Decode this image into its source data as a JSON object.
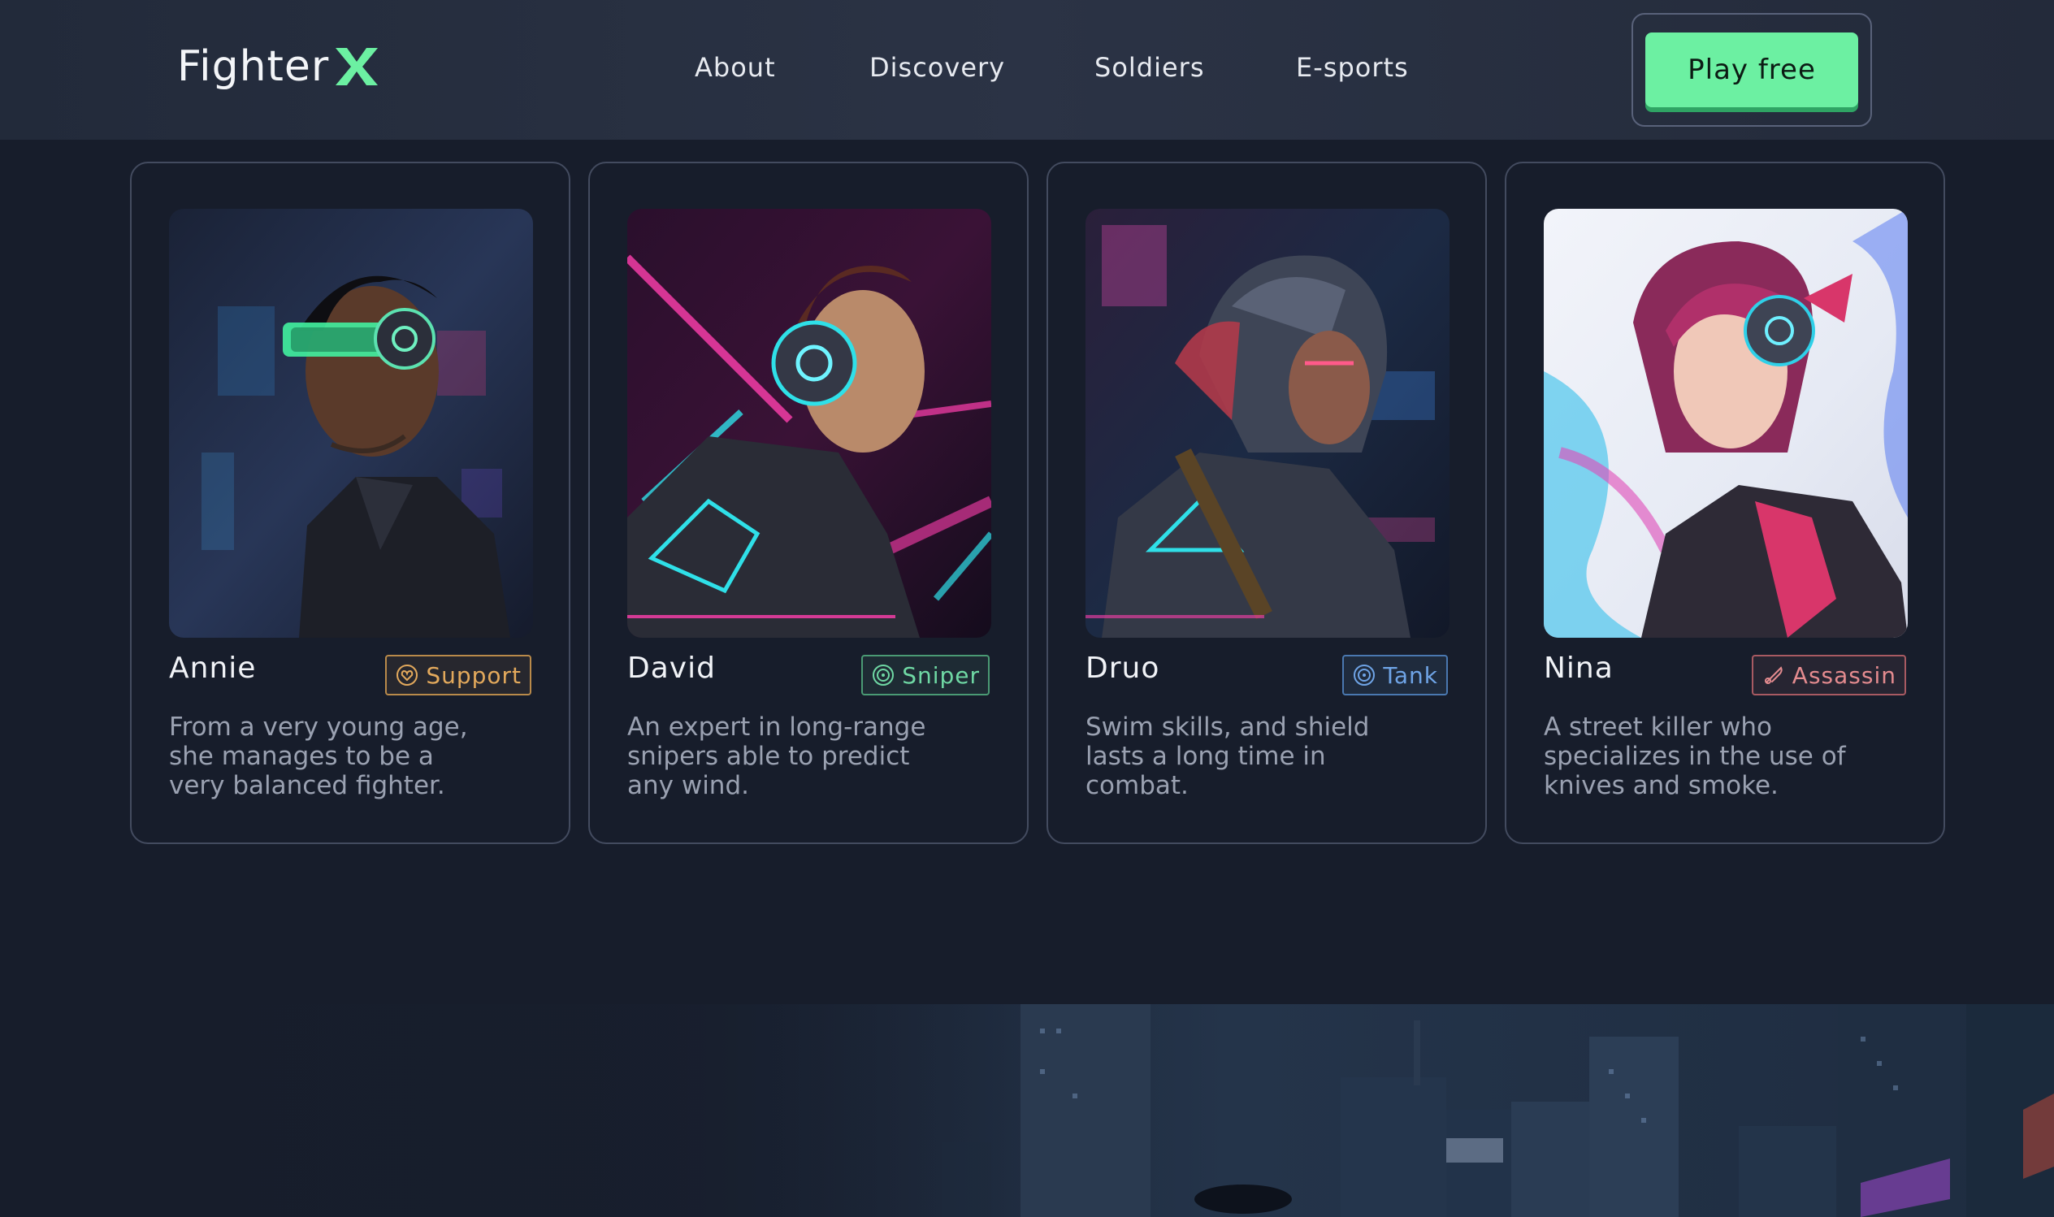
{
  "brand": {
    "name": "Fighter",
    "mark": "X",
    "accent": "#6cf0a2"
  },
  "nav": {
    "items": [
      "About",
      "Discovery",
      "Soldiers",
      "E-sports"
    ]
  },
  "cta": {
    "label": "Play free"
  },
  "cards": [
    {
      "name": "Annie",
      "role": "Support",
      "role_icon": "heart-shield-icon",
      "role_color": "#e3a95c",
      "description": "From a very young age, she manages to be a very balanced fighter."
    },
    {
      "name": "David",
      "role": "Sniper",
      "role_icon": "target-icon",
      "role_color": "#6fd8a4",
      "description": "An expert in long-range snipers able to predict any wind."
    },
    {
      "name": "Druo",
      "role": "Tank",
      "role_icon": "target-icon",
      "role_color": "#6fa4e6",
      "description": "Swim skills, and shield lasts a long time in combat."
    },
    {
      "name": "Nina",
      "role": "Assassin",
      "role_icon": "knife-icon",
      "role_color": "#e48b8f",
      "description": "A street killer who specializes in the use of knives and smoke."
    }
  ]
}
